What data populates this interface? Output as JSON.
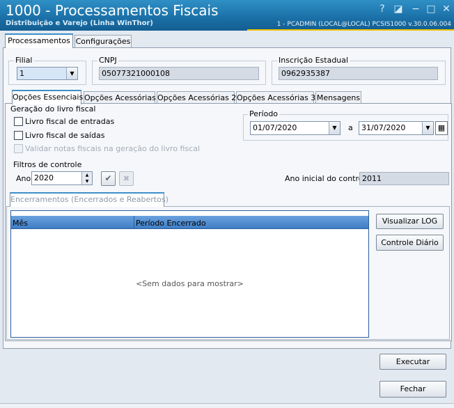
{
  "window": {
    "title": "1000 - Processamentos Fiscais",
    "subtitle": "Distribuição e Varejo (Linha WinThor)",
    "session_info": "1 - PCADMIN (LOCAL@LOCAL)   PCSIS1000  v.30.0.06.004",
    "controls": [
      "?",
      "◪",
      "−",
      "□",
      "✕"
    ]
  },
  "top_tabs": [
    {
      "label": "Processamentos",
      "active": true
    },
    {
      "label": "Configurações",
      "active": false
    }
  ],
  "filial": {
    "label": "Filial",
    "value": "1"
  },
  "cnpj": {
    "label": "CNPJ",
    "value": "05077321000108"
  },
  "inscricao": {
    "label": "Inscrição Estadual",
    "value": "0962935387"
  },
  "inner_tabs": [
    {
      "label": "Opções Essenciais",
      "active": true
    },
    {
      "label": "Opções Acessórias",
      "active": false
    },
    {
      "label": "Opções Acessórias 2",
      "active": false
    },
    {
      "label": "Opções Acessórias 3",
      "active": false
    },
    {
      "label": "Mensagens",
      "active": false
    }
  ],
  "geracao": {
    "label": "Geração do livro fiscal",
    "entradas": "Livro fiscal de entradas",
    "saidas": "Livro fiscal de saídas",
    "validar": "Validar notas fiscais na geração do livro fiscal"
  },
  "periodo": {
    "label": "Período",
    "start": "01/07/2020",
    "separator": "a",
    "end": "31/07/2020"
  },
  "filtros": {
    "label": "Filtros de controle",
    "ano_label": "Ano",
    "ano_value": "2020",
    "ano_inicial_label": "Ano inicial do controle",
    "ano_inicial_value": "2011"
  },
  "encerramentos": {
    "tab_label": "Encerramentos (Encerrados e Reabertos)",
    "columns": [
      "Mês",
      "Período Encerrado"
    ],
    "empty_text": "<Sem dados para mostrar>"
  },
  "buttons": {
    "visualizar_log": "Visualizar LOG",
    "controle_diario": "Controle Diário",
    "executar": "Executar",
    "fechar": "Fechar"
  },
  "colors": {
    "accent": "#3d8fc9",
    "titlebar": "#1a6fa6",
    "grid_header": "#4a88cf"
  }
}
